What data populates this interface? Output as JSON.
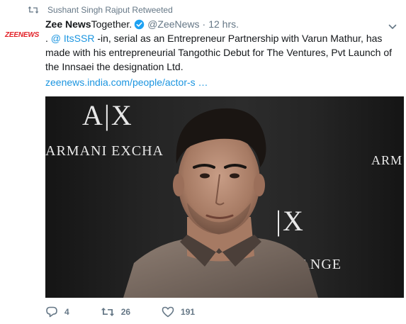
{
  "retweet_bar": {
    "text": "Sushant Singh Rajput Retweeted"
  },
  "author": {
    "avatar_text": "ZEENEWS",
    "name": "Zee News",
    "name_suffix": "Together.",
    "handle": "@ZeeNews",
    "dot": "·",
    "time": "12 hrs."
  },
  "tweet": {
    "line1_prefix": ". ",
    "mention": "@ ItsSSR",
    "line1_rest": " -in, serial as an Entrepreneur Partnership with Varun Mathur, has made with his entrepreneurial Tangothic Debut for The Ventures, Pvt Launch of the Innsaei the designation Ltd.",
    "link": "zeenews.india.com/people/actor-s …"
  },
  "media": {
    "ax_left": "A|X",
    "armani_left": "ARMANI EXCHA",
    "armani_right": "ARM",
    "ax_right": "|X",
    "exchange_right": "EXCHANGE"
  },
  "actions": {
    "reply_count": "4",
    "retweet_count": "26",
    "like_count": "191"
  },
  "colors": {
    "link": "#1b95e0",
    "secondary_text": "#657786",
    "verified": "#1da1f2",
    "logo_red": "#e21f26"
  }
}
